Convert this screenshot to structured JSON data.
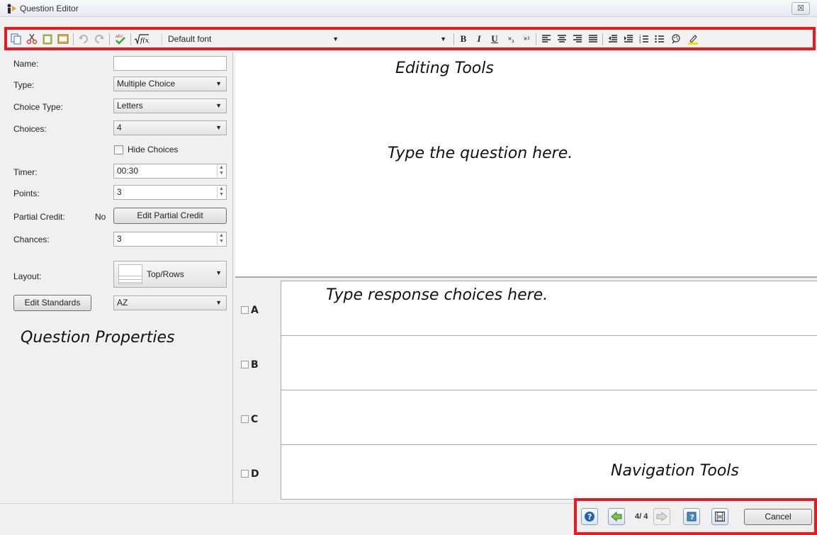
{
  "window": {
    "title": "Question Editor",
    "close_glyph": "☒"
  },
  "toolbar": {
    "icons": [
      "copy-icon",
      "cut-icon",
      "paste-icon",
      "paste-special-icon",
      "undo-icon",
      "redo-icon",
      "spellcheck-icon",
      "equation-icon"
    ],
    "font_value": "Default font",
    "size_value": "",
    "format": {
      "bold": "B",
      "italic": "I",
      "underline": "U",
      "subscript": "×₂",
      "superscript": "×²"
    }
  },
  "properties": {
    "name_label": "Name:",
    "name_value": "",
    "type_label": "Type:",
    "type_value": "Multiple Choice",
    "choice_type_label": "Choice Type:",
    "choice_type_value": "Letters",
    "choices_label": "Choices:",
    "choices_value": "4",
    "hide_choices_label": "Hide Choices",
    "timer_label": "Timer:",
    "timer_value": "00:30",
    "points_label": "Points:",
    "points_value": "3",
    "partial_credit_label": "Partial Credit:",
    "partial_credit_value": "No",
    "edit_partial_credit": "Edit Partial Credit",
    "chances_label": "Chances:",
    "chances_value": "3",
    "layout_label": "Layout:",
    "layout_value": "Top/Rows",
    "edit_standards": "Edit Standards",
    "standards_value": "AZ"
  },
  "annotations": {
    "editing_tools": "Editing Tools",
    "question_hint": "Type the question here.",
    "choices_hint": "Type response choices here.",
    "question_properties": "Question Properties",
    "navigation_tools": "Navigation Tools"
  },
  "choices": [
    {
      "letter": "A"
    },
    {
      "letter": "B"
    },
    {
      "letter": "C"
    },
    {
      "letter": "D"
    }
  ],
  "navigation": {
    "page_indicator": "4/ 4",
    "cancel_label": "Cancel"
  },
  "colors": {
    "highlight_border": "#e8191f",
    "nav_blue": "#1f62b4",
    "nav_green": "#3aa33a"
  }
}
